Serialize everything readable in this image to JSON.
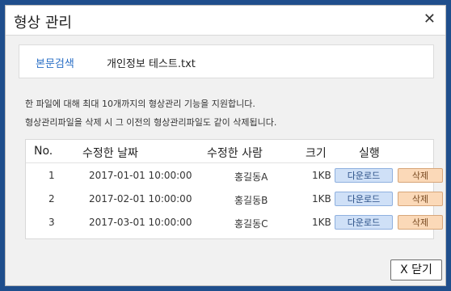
{
  "dialog": {
    "title": "형상 관리",
    "close_icon": "✕"
  },
  "search": {
    "link_label": "본문검색",
    "file_name": "개인정보 테스트.txt"
  },
  "notices": [
    "한 파일에 대해 최대 10개까지의 형상관리 기능을 지원합니다.",
    "형상관리파일을 삭제 시 그 이전의 형상관리파일도 같이 삭제됩니다."
  ],
  "table": {
    "columns": [
      "No.",
      "수정한 날짜",
      "수정한 사람",
      "크기",
      "실행"
    ],
    "rows": [
      {
        "no": "1",
        "date": "2017-01-01 10:00:00",
        "user": "홍길동A",
        "size": "1KB"
      },
      {
        "no": "2",
        "date": "2017-02-01 10:00:00",
        "user": "홍길동B",
        "size": "1KB"
      },
      {
        "no": "3",
        "date": "2017-03-01 10:00:00",
        "user": "홍길동C",
        "size": "1KB"
      }
    ],
    "download_label": "다운로드",
    "delete_label": "삭제"
  },
  "footer": {
    "close_label": "X 닫기"
  }
}
